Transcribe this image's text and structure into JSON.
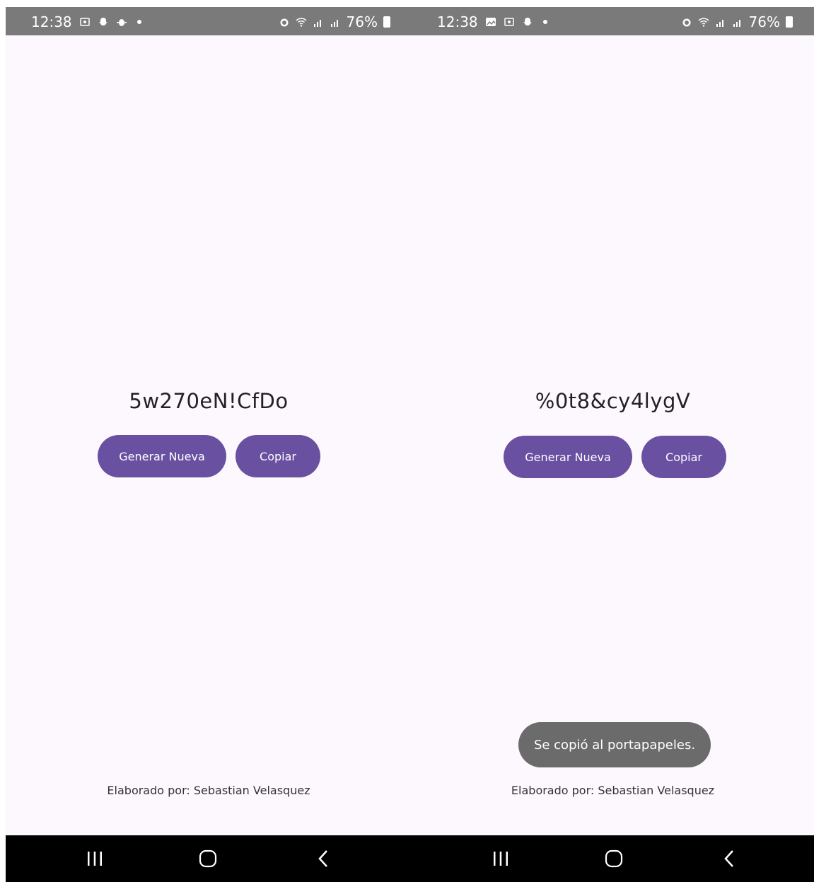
{
  "screens": [
    {
      "status_time": "12:38",
      "status_icons_left": [
        "screenshot-icon",
        "snapchat-icon",
        "bug-icon",
        "dot-icon"
      ],
      "status_icons_right": [
        "alarm-icon",
        "wifi-icon",
        "signal-icon",
        "signal-icon",
        "battery-icon"
      ],
      "battery_percent": "76%",
      "password": "5w270eN!CfDo",
      "generate_label": "Generar Nueva",
      "copy_label": "Copiar",
      "toast": "",
      "footer": "Elaborado por: Sebastian Velasquez"
    },
    {
      "status_time": "12:38",
      "status_icons_left": [
        "gallery-icon",
        "screenshot-icon",
        "snapchat-icon",
        "dot-icon"
      ],
      "status_icons_right": [
        "alarm-icon",
        "wifi-icon",
        "signal-icon",
        "signal-icon",
        "battery-icon"
      ],
      "battery_percent": "76%",
      "password": "%0t8&cy4lygV",
      "generate_label": "Generar Nueva",
      "copy_label": "Copiar",
      "toast": "Se copió al portapapeles.",
      "footer": "Elaborado por: Sebastian Velasquez"
    }
  ],
  "colors": {
    "primary_button": "#6950a1",
    "status_bar": "#7a7a7a",
    "background": "#fdf8fd",
    "toast": "#6b6b6b",
    "nav_bar": "#000000"
  }
}
